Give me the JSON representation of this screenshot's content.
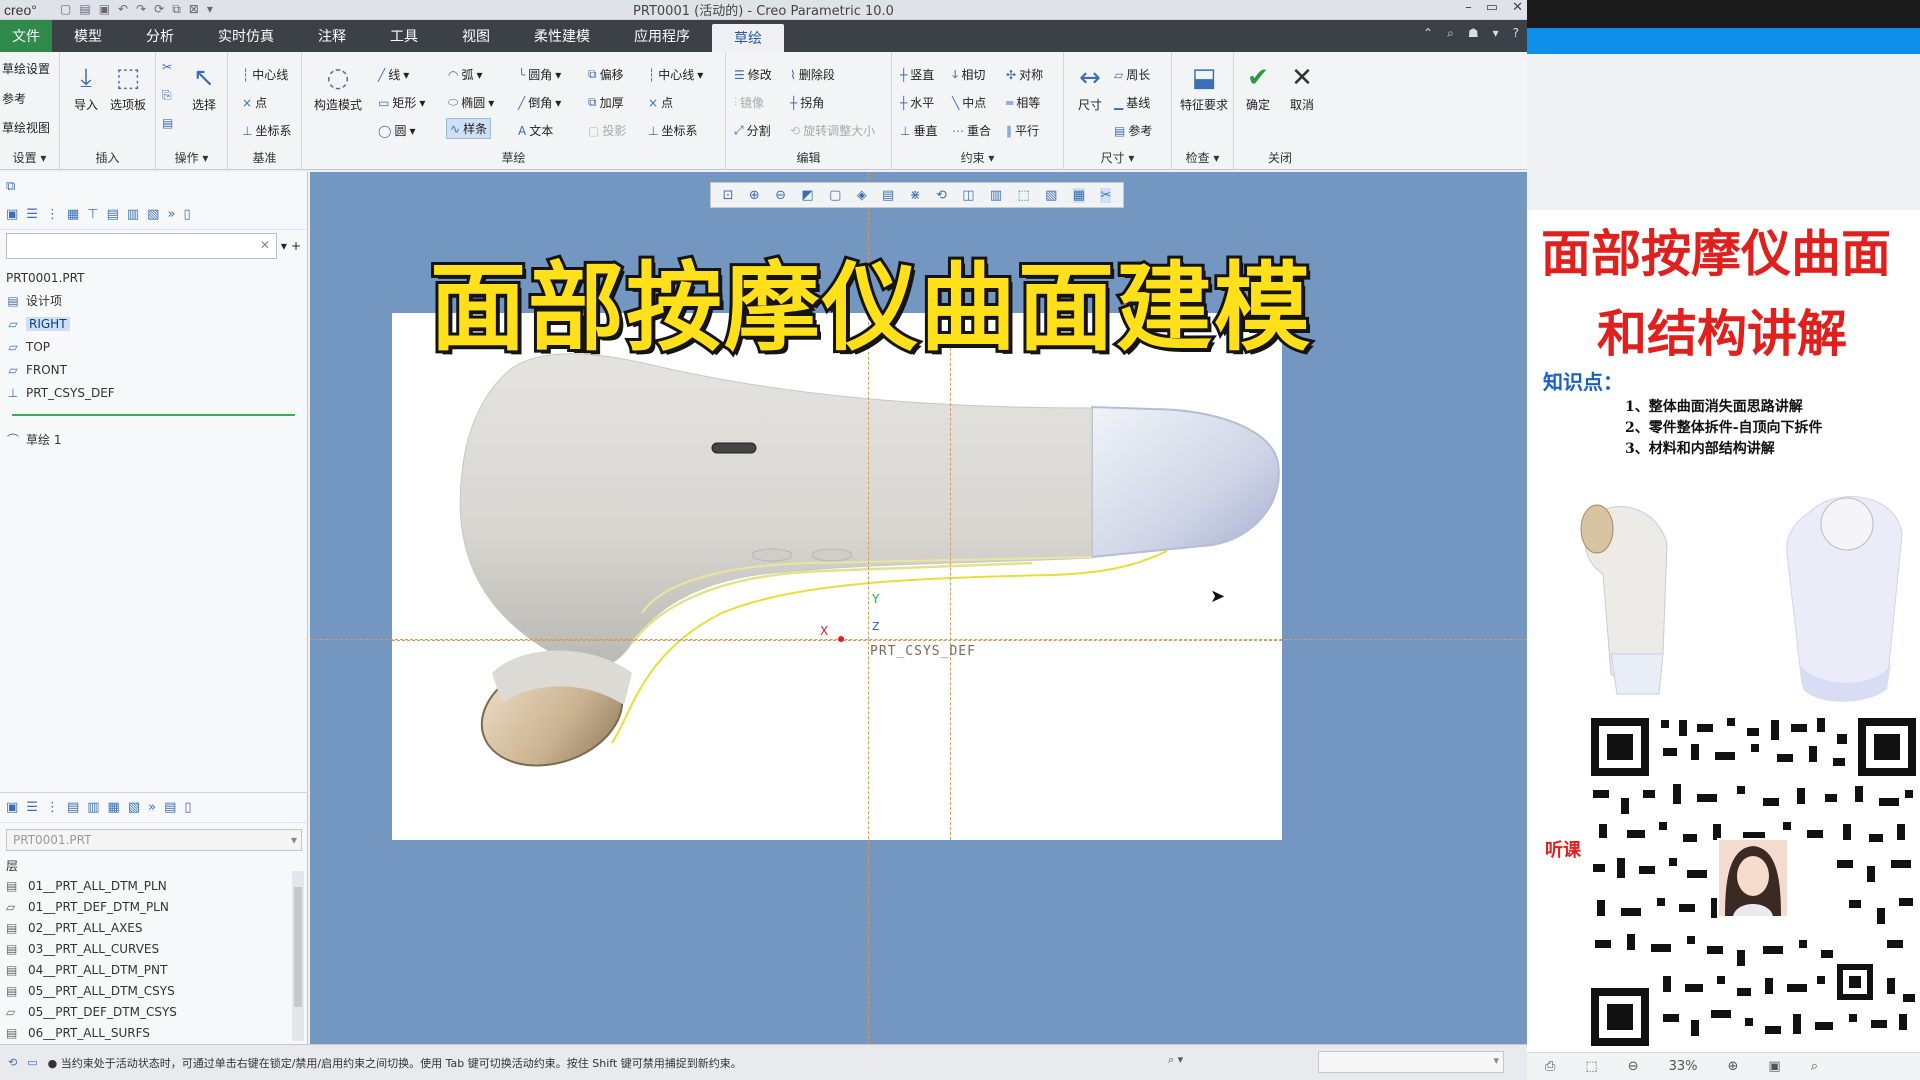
{
  "window": {
    "logo": "creo°",
    "title": "PRT0001 (活动的) - Creo Parametric 10.0",
    "controls": [
      "–",
      "▭",
      "✕"
    ]
  },
  "menu": {
    "file": "文件",
    "items": [
      "模型",
      "分析",
      "实时仿真",
      "注释",
      "工具",
      "视图",
      "柔性建模",
      "应用程序"
    ],
    "active": "草绘"
  },
  "ribbon": {
    "setup": {
      "items": [
        "草绘设置",
        "参考",
        "草绘视图"
      ],
      "label": "设置"
    },
    "insert": {
      "import": "导入",
      "palette": "选项板",
      "label": "插入"
    },
    "ops": {
      "select": "选择",
      "label": "操作"
    },
    "datum": {
      "items": [
        "中心线",
        "点",
        "坐标系"
      ],
      "label": "基准"
    },
    "sketch": {
      "construct": "构造模式",
      "col1": [
        "线",
        "矩形",
        "圆"
      ],
      "col2": [
        "弧",
        "椭圆",
        "样条"
      ],
      "col3": [
        "圆角",
        "倒角",
        "文本"
      ],
      "col4": [
        "偏移",
        "加厚",
        "投影"
      ],
      "col5": [
        "中心线",
        "点",
        "坐标系"
      ],
      "label": "草绘"
    },
    "edit": {
      "items": [
        "修改",
        "删除段",
        "镜像",
        "拐角",
        "分割",
        "旋转调整大小"
      ],
      "label": "编辑"
    },
    "constrain": {
      "items": [
        "竖直",
        "相切",
        "对称",
        "水平",
        "中点",
        "相等",
        "垂直",
        "重合",
        "平行"
      ],
      "label": "约束"
    },
    "dimension": {
      "dim": "尺寸",
      "items": [
        "周长",
        "基线",
        "参考"
      ],
      "label": "尺寸"
    },
    "inspect": {
      "feature": "特征要求",
      "label": "检查"
    },
    "close": {
      "ok": "确定",
      "cancel": "取消",
      "label": "关闭"
    }
  },
  "model_tree": {
    "root": "PRT0001.PRT",
    "items": [
      "设计项",
      "RIGHT",
      "TOP",
      "FRONT",
      "PRT_CSYS_DEF"
    ],
    "selected": "RIGHT",
    "sketch": "草绘 1"
  },
  "layers": {
    "combo": "PRT0001.PRT",
    "header": "层",
    "items": [
      "01__PRT_ALL_DTM_PLN",
      "01__PRT_DEF_DTM_PLN",
      "02__PRT_ALL_AXES",
      "03__PRT_ALL_CURVES",
      "04__PRT_ALL_DTM_PNT",
      "05__PRT_ALL_DTM_CSYS",
      "05__PRT_DEF_DTM_CSYS",
      "06__PRT_ALL_SURFS"
    ]
  },
  "viewport": {
    "overlay_title": "面部按摩仪曲面建模",
    "csys_label": "PRT_CSYS_DEF",
    "axis_x": "X",
    "axis_y": "Y",
    "axis_z": "Z"
  },
  "status": {
    "message": "● 当约束处于活动状态时，可通过单击右键在锁定/禁用/启用约束之间切换。使用 Tab 键可切换活动约束。按住 Shift 键可禁用捕捉到新约束。"
  },
  "poster": {
    "title_line1": "面部按摩仪曲面",
    "title_line2": "和结构讲解",
    "knowledge": "知识点：",
    "points": [
      "1、整体曲面消失面思路讲解",
      "2、零件整体拆件-自顶向下拆件",
      "3、材料和内部结构讲解"
    ],
    "listen": "听课",
    "zoom": "33%"
  },
  "colors": {
    "viewport_bg": "#7497c1",
    "menubar": "#3c4148",
    "file_tab": "#2f8a4c",
    "title_yellow": "#ffe01a",
    "poster_red": "#e0201c"
  }
}
